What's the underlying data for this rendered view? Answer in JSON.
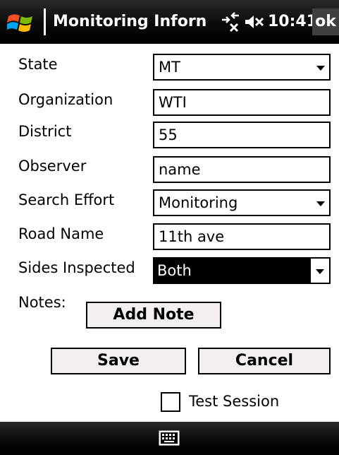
{
  "titlebar": {
    "title": "Monitoring Inforn",
    "time": "10:41",
    "ok_label": "ok"
  },
  "form": {
    "state": {
      "label": "State",
      "value": "MT"
    },
    "organization": {
      "label": "Organization",
      "value": "WTI"
    },
    "district": {
      "label": "District",
      "value": "55"
    },
    "observer": {
      "label": "Observer",
      "value": "name"
    },
    "search_effort": {
      "label": "Search Effort",
      "value": "Monitoring"
    },
    "road_name": {
      "label": "Road Name",
      "value": "11th ave"
    },
    "sides_inspected": {
      "label": "Sides Inspected",
      "value": "Both"
    },
    "notes": {
      "label": "Notes:",
      "add_note_label": "Add Note"
    }
  },
  "actions": {
    "save_label": "Save",
    "cancel_label": "Cancel"
  },
  "test_session": {
    "label": "Test Session",
    "checked": false
  },
  "icons": [
    "windows-start-icon",
    "connectivity-icon",
    "volume-muted-icon",
    "keyboard-icon"
  ],
  "colors": {
    "bar": "#000000",
    "button_bg": "#f3eef0",
    "selected_bg": "#000000"
  }
}
